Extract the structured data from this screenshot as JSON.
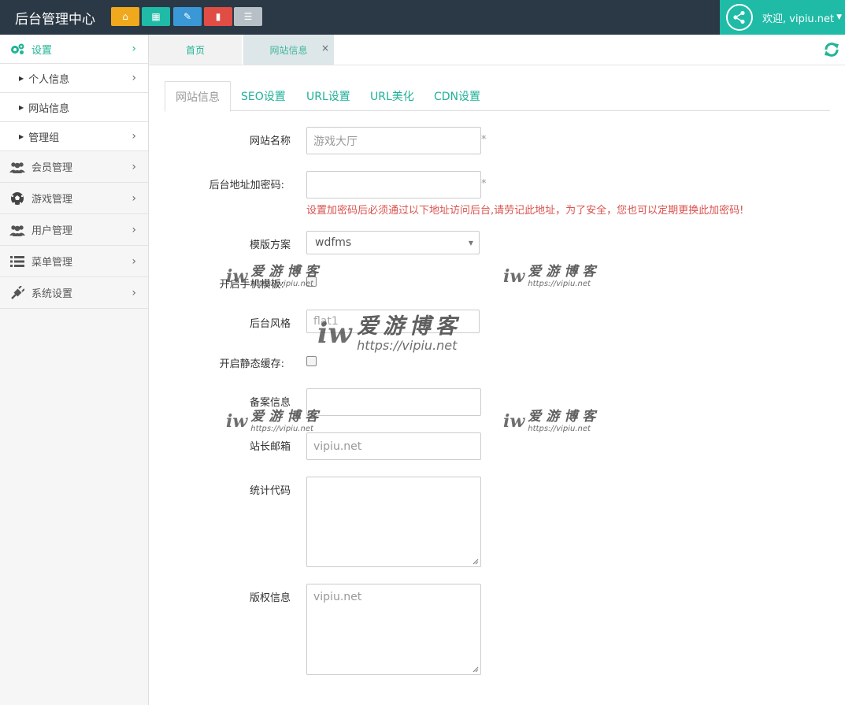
{
  "app_title": "后台管理中心",
  "topbar": {
    "quick_buttons": [
      {
        "name": "home",
        "icon": "home-icon",
        "color": "#f0a91c",
        "glyph": "⌂"
      },
      {
        "name": "grid",
        "icon": "grid-icon",
        "color": "#1fbba6",
        "glyph": "▦"
      },
      {
        "name": "edit",
        "icon": "pencil-icon",
        "color": "#3a98d6",
        "glyph": "✎"
      },
      {
        "name": "delete",
        "icon": "trash-icon",
        "color": "#df4d45",
        "glyph": "▮"
      },
      {
        "name": "list",
        "icon": "list-icon",
        "color": "#b7c0c6",
        "glyph": "☰"
      }
    ],
    "user_label": "欢迎, vipiu.net",
    "user_color": "#1fbba6"
  },
  "sidebar": {
    "header": {
      "label": "设置",
      "icon": "gears-icon"
    },
    "sub_items": [
      {
        "label": "个人信息",
        "has_chevron": true
      },
      {
        "label": "网站信息",
        "has_chevron": false
      },
      {
        "label": "管理组",
        "has_chevron": true
      }
    ],
    "items": [
      {
        "label": "会员管理",
        "icon": "users-icon"
      },
      {
        "label": "游戏管理",
        "icon": "soccer-ball-icon"
      },
      {
        "label": "用户管理",
        "icon": "users-icon"
      },
      {
        "label": "菜单管理",
        "icon": "list-icon"
      },
      {
        "label": "系统设置",
        "icon": "plug-icon"
      }
    ]
  },
  "page_tabs": [
    {
      "label": "首页",
      "closable": false
    },
    {
      "label": "网站信息",
      "closable": true,
      "close_glyph": "×"
    }
  ],
  "content_tabs": [
    "网站信息",
    "SEO设置",
    "URL设置",
    "URL美化",
    "CDN设置"
  ],
  "form": {
    "site_name": {
      "label": "网站名称",
      "value": "游戏大厅",
      "required": "*"
    },
    "admin_key": {
      "label": "后台地址加密码:",
      "value": "",
      "required": "*",
      "hint": "设置加密码后必须通过以下地址访问后台,请劳记此地址，为了安全，您也可以定期更换此加密码!"
    },
    "template": {
      "label": "模版方案",
      "value": "wdfms"
    },
    "mobile_template": {
      "label": "开启手机模板:",
      "checked": false
    },
    "admin_style": {
      "label": "后台风格",
      "value": "flat1"
    },
    "static_cache": {
      "label": "开启静态缓存:",
      "checked": false
    },
    "icp": {
      "label": "备案信息",
      "value": ""
    },
    "webmaster_email": {
      "label": "站长邮箱",
      "value": "vipiu.net"
    },
    "stats_code": {
      "label": "统计代码",
      "value": ""
    },
    "copyright": {
      "label": "版权信息",
      "value": "vipiu.net"
    }
  },
  "watermark": {
    "logo": "iw",
    "title": "爱游博客",
    "url": "https://vipiu.net"
  },
  "colors": {
    "accent": "#22b496",
    "topbar": "#2b3845",
    "error": "#d9534f"
  }
}
